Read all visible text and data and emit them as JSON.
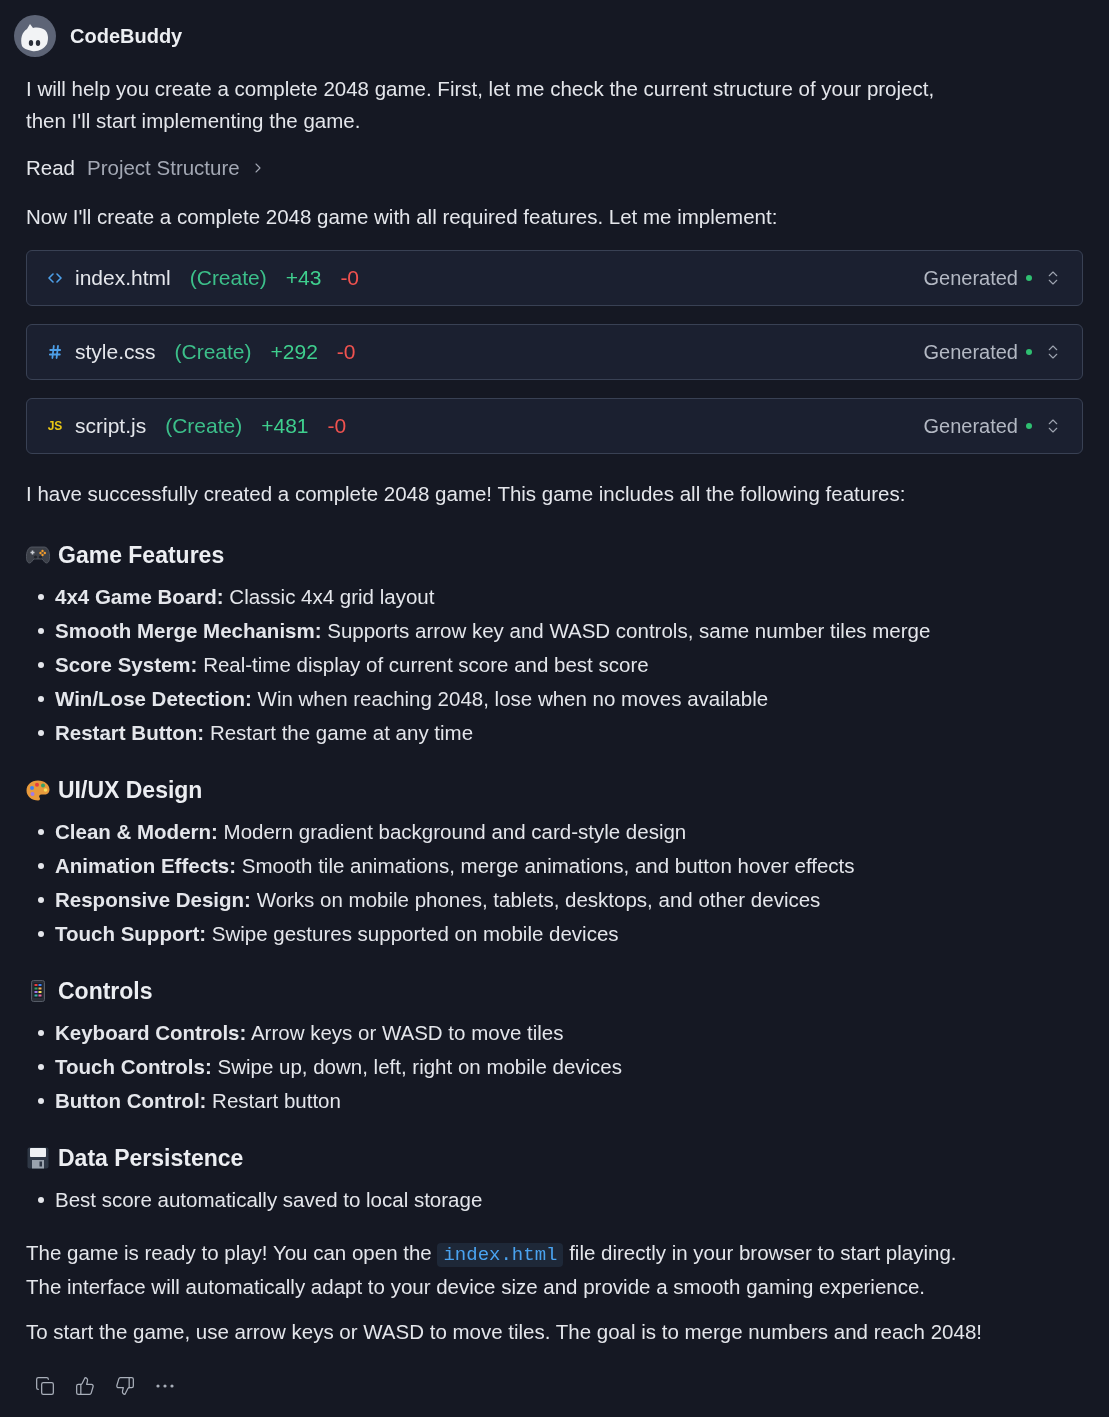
{
  "assistant": {
    "name": "CodeBuddy"
  },
  "intro": {
    "lines": [
      "I will help you create a complete 2048 game. First, let me check the current structure of your project,",
      "then I'll start implementing the game."
    ]
  },
  "tool_step": {
    "action": "Read",
    "target": "Project Structure"
  },
  "lead_in": "Now I'll create a complete 2048 game with all required features. Let me implement:",
  "files": [
    {
      "kind": "html",
      "name": "index.html",
      "operation": "(Create)",
      "added": "+43",
      "removed": "-0",
      "status": "Generated",
      "color": "#2fbf71"
    },
    {
      "kind": "css",
      "name": "style.css",
      "operation": "(Create)",
      "added": "+292",
      "removed": "-0",
      "status": "Generated",
      "color": "#2fbf71"
    },
    {
      "kind": "js",
      "badge": "JS",
      "name": "script.js",
      "operation": "(Create)",
      "added": "+481",
      "removed": "-0",
      "status": "Generated",
      "color": "#2fbf71"
    }
  ],
  "summary": "I have successfully created a complete 2048 game! This game includes all the following features:",
  "sections": [
    {
      "title": "Game Features",
      "items": [
        "**4x4 Game Board:** Classic 4x4 grid layout",
        "**Smooth Merge Mechanism:** Supports arrow key and WASD controls, same number tiles merge",
        "**Score System:** Real-time display of current score and best score",
        "**Win/Lose Detection:** Win when reaching 2048, lose when no moves available",
        "**Restart Button:** Restart the game at any time"
      ]
    },
    {
      "title": "UI/UX Design",
      "items": [
        "**Clean & Modern:** Modern gradient background and card-style design",
        "**Animation Effects:** Smooth tile animations, merge animations, and button hover effects",
        "**Responsive Design:** Works on mobile phones, tablets, desktops, and other devices",
        "**Touch Support:** Swipe gestures supported on mobile devices"
      ]
    },
    {
      "title": "Controls",
      "items": [
        "**Keyboard Controls:** Arrow keys or WASD to move tiles",
        "**Touch Controls:** Swipe up, down, left, right on mobile devices",
        "**Button Control:** Restart button"
      ]
    },
    {
      "title": "Data Persistence",
      "items": [
        "Best score automatically saved to local storage"
      ]
    }
  ],
  "closing": [
    {
      "lines": [
        [
          {
            "kind": "text",
            "text": "The game is ready to play! You can open the "
          },
          {
            "kind": "code",
            "text": "index.html"
          },
          {
            "kind": "text",
            "text": " file directly in your browser to start playing."
          }
        ],
        [
          {
            "kind": "text",
            "text": "The interface will automatically adapt to your device size and provide a smooth gaming experience."
          }
        ]
      ]
    },
    {
      "lines": [
        [
          {
            "kind": "text",
            "text": "To start the game, use arrow keys or WASD to move tiles. The goal is to merge numbers and reach 2048!"
          }
        ]
      ]
    }
  ]
}
